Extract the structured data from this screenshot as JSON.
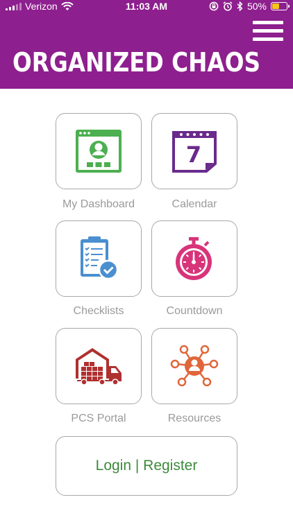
{
  "status_bar": {
    "carrier": "Verizon",
    "time": "11:03 AM",
    "battery": "50%",
    "battery_level": 0.5,
    "icons": [
      "signal-icon",
      "wifi-icon",
      "orientation-lock-icon",
      "alarm-icon",
      "bluetooth-icon",
      "battery-icon"
    ]
  },
  "header": {
    "title": "ORGANIZED CHAOS",
    "background": "#8e1f8e",
    "menu_icon": "hamburger-menu-icon"
  },
  "tiles": [
    {
      "label": "My Dashboard",
      "icon": "dashboard-icon",
      "color": "#4caf50"
    },
    {
      "label": "Calendar",
      "icon": "calendar-icon",
      "color": "#6a2a8c",
      "day": "7"
    },
    {
      "label": "Checklists",
      "icon": "checklist-icon",
      "color": "#4a8fd0"
    },
    {
      "label": "Countdown",
      "icon": "stopwatch-icon",
      "color": "#d8347a"
    },
    {
      "label": "PCS Portal",
      "icon": "moving-truck-icon",
      "color": "#b03030"
    },
    {
      "label": "Resources",
      "icon": "network-people-icon",
      "color": "#e0663a"
    }
  ],
  "login": {
    "label": "Login | Register",
    "color": "#3c8a3a"
  }
}
